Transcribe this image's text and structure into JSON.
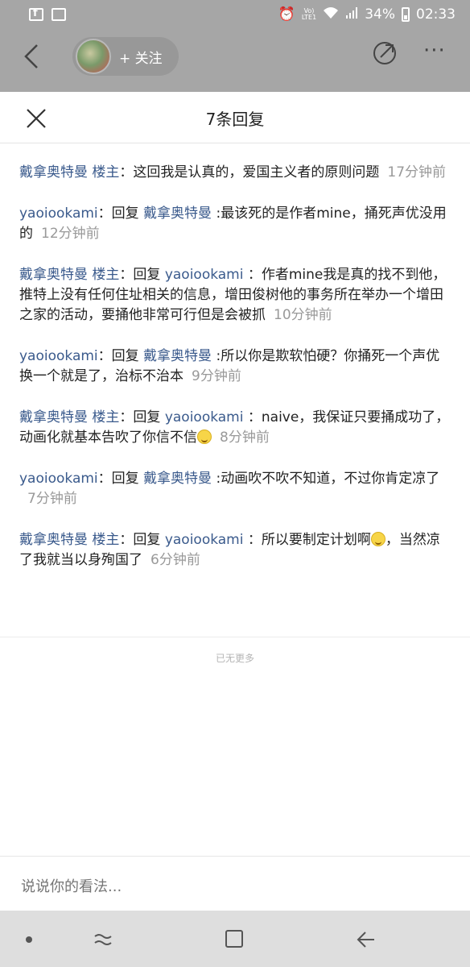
{
  "status_bar": {
    "battery": "34%",
    "time": "02:33",
    "network": "LTE1",
    "volte": "Vo)"
  },
  "header": {
    "follow_label": "+ 关注"
  },
  "sheet": {
    "title": "7条回复",
    "replies": [
      {
        "user": "戴拿奥特曼",
        "tag": "楼主",
        "reply_word": "",
        "reply_to": "",
        "text": "：这回我是认真的，爱国主义者的原则问题",
        "time": "17分钟前"
      },
      {
        "user": "yaoiookami",
        "tag": "",
        "reply_word": "：回复 ",
        "reply_to": "戴拿奥特曼",
        "text": " :最该死的是作者mine，捅死声优没用的",
        "time": "12分钟前"
      },
      {
        "user": "戴拿奥特曼",
        "tag": "楼主",
        "reply_word": "：回复 ",
        "reply_to": "yaoiookami",
        "text": " ：作者mine我是真的找不到他，推特上没有任何住址相关的信息，增田俊树他的事务所在举办一个增田之家的活动，要捅他非常可行但是会被抓",
        "time": "10分钟前"
      },
      {
        "user": "yaoiookami",
        "tag": "",
        "reply_word": "：回复 ",
        "reply_to": "戴拿奥特曼",
        "text": " :所以你是欺软怕硬？你捅死一个声优换一个就是了，治标不治本",
        "time": "9分钟前"
      },
      {
        "user": "戴拿奥特曼",
        "tag": "楼主",
        "reply_word": "：回复 ",
        "reply_to": "yaoiookami",
        "text": " ：naive，我保证只要捅成功了，动画化就基本告吹了你信不信",
        "time": "8分钟前"
      },
      {
        "user": "yaoiookami",
        "tag": "",
        "reply_word": "：回复 ",
        "reply_to": "戴拿奥特曼",
        "text": " :动画吹不吹不知道，不过你肯定凉了",
        "time": "7分钟前"
      },
      {
        "user": "戴拿奥特曼",
        "tag": "楼主",
        "reply_word": "：回复 ",
        "reply_to": "yaoiookami",
        "text": " ：所以要制定计划啊",
        "text2": "，当然凉了我就当以身殉国了",
        "time": "6分钟前"
      }
    ],
    "no_more": "已无更多"
  },
  "input": {
    "placeholder": "说说你的看法..."
  }
}
